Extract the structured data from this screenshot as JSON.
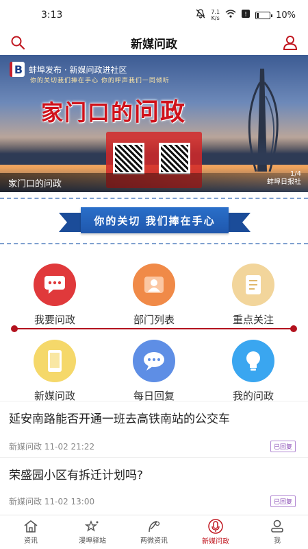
{
  "status_bar": {
    "time": "3:13",
    "net_speed": "7.1",
    "net_unit": "K/s",
    "battery": "10%"
  },
  "header": {
    "title": "新媒问政",
    "left_icon": "search-icon",
    "right_icon": "user-icon"
  },
  "banner": {
    "brand": "蚌埠发布 · 新媒问政进社区",
    "brand_logo": "B",
    "subline": "你的关切我们捧在手心   你的呼声我们一同倾听",
    "headline_pre": "家门口的",
    "headline_accent": "问政",
    "caption": "家门口的问政",
    "pager": "1/4",
    "source": "蚌埠日报社"
  },
  "slogan": "你的关切  我们捧在手心",
  "grid": [
    {
      "label": "我要问政",
      "color": "#e0393b",
      "icon": "message-icon"
    },
    {
      "label": "部门列表",
      "color": "#f08a48",
      "icon": "people-icon"
    },
    {
      "label": "重点关注",
      "color": "#f2d59b",
      "icon": "document-icon"
    },
    {
      "label": "新媒问政",
      "color": "#f5d86a",
      "icon": "phone-icon"
    },
    {
      "label": "每日回复",
      "color": "#5e8ee5",
      "icon": "chat-icon"
    },
    {
      "label": "我的问政",
      "color": "#3aa6f0",
      "icon": "lightbulb-icon"
    }
  ],
  "news": [
    {
      "title": "延安南路能否开通一班去高铁南站的公交车",
      "source": "新媒问政",
      "time": "11-02 21:22",
      "badge": "已回复"
    },
    {
      "title": "荣盛园小区有拆迁计划吗?",
      "source": "新媒问政",
      "time": "11-02 13:00",
      "badge": "已回复"
    }
  ],
  "tabs": [
    {
      "label": "资讯",
      "icon": "home-icon",
      "active": false
    },
    {
      "label": "漫埠驿站",
      "icon": "stars-icon",
      "active": false
    },
    {
      "label": "两微资讯",
      "icon": "feather-icon",
      "active": false
    },
    {
      "label": "新媒问政",
      "icon": "microphone-icon",
      "active": true
    },
    {
      "label": "我",
      "icon": "profile-icon",
      "active": false
    }
  ],
  "colors": {
    "accent": "#c0161f",
    "ribbon": "#1f57ad"
  }
}
